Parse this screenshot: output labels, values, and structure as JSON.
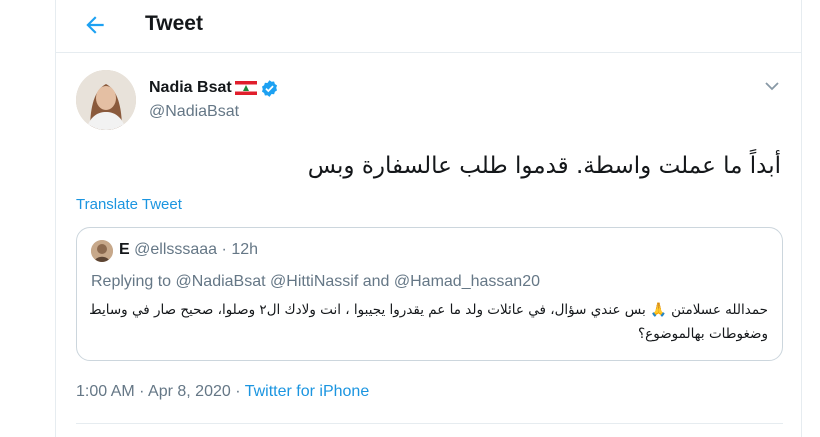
{
  "header": {
    "title": "Tweet"
  },
  "tweet": {
    "author_name": "Nadia Bsat",
    "author_handle": "@NadiaBsat",
    "text": "أبداً ما عملت واسطة. قدموا طلب عالسفارة وبس",
    "translate_label": "Translate Tweet",
    "time": "1:00 AM",
    "separator": "·",
    "date": "Apr 8, 2020",
    "source": "Twitter for iPhone"
  },
  "quoted": {
    "name": "E",
    "handle": "@ellsssaaa",
    "dot": "·",
    "time": "12h",
    "replying_prefix": "Replying to",
    "mention_1": "@NadiaBsat",
    "mention_2": "@HittiNassif",
    "and_word": "and",
    "mention_3": "@Hamad_hassan20",
    "text": "حمدالله عسلامتن 🙏 بس عندي سؤال، في عائلات ولد ما عم يقدروا يجيبوا ، انت ولادك ال٢ وصلوا، صحيح صار في وسايط وضغوطات بهالموضوع؟"
  },
  "colors": {
    "accent": "#1da1f2",
    "link": "#1b95e0",
    "muted": "#657786",
    "border": "#e6ecf0"
  },
  "icons": {
    "back": "arrow-left-icon",
    "verified": "verified-badge-icon",
    "more": "chevron-down-icon",
    "flag": "lebanon-flag-icon"
  }
}
